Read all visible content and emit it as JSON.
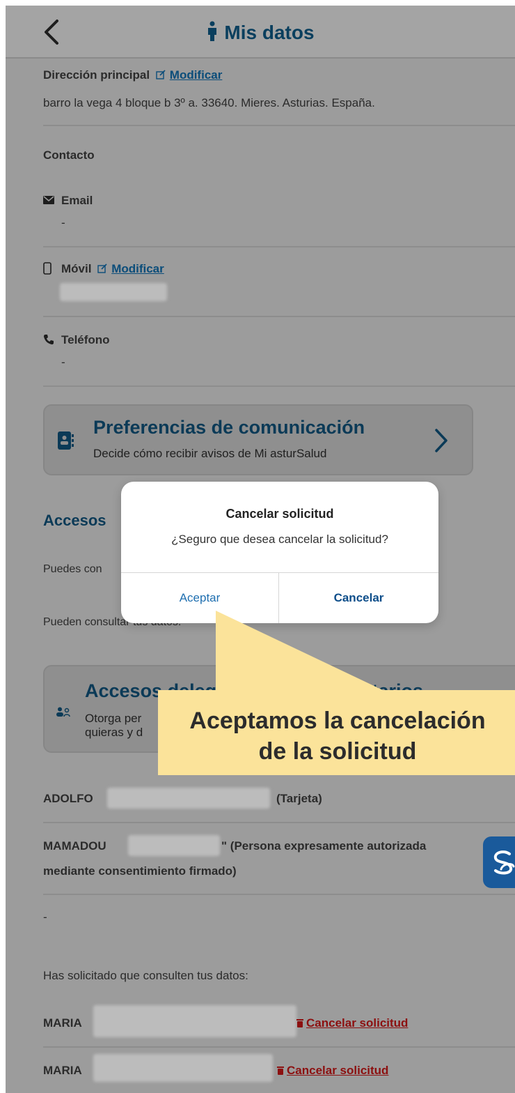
{
  "header": {
    "title": "Mis datos"
  },
  "address": {
    "label": "Dirección principal",
    "modify": "Modificar",
    "value": "barro la vega 4 bloque b 3º a. 33640. Mieres. Asturias. España."
  },
  "contact": {
    "heading": "Contacto",
    "email_label": "Email",
    "email_value": "-",
    "mobile_label": "Móvil",
    "mobile_modify": "Modificar",
    "phone_label": "Teléfono",
    "phone_value": "-"
  },
  "preferences_card": {
    "title": "Preferencias de comunicación",
    "subtitle": "Decide cómo recibir avisos de Mi asturSalud"
  },
  "accesses": {
    "title_partial": "Accesos",
    "line1_partial": "Puedes con",
    "line2_partial": "Pueden consultar tus datos:"
  },
  "voluntary_card": {
    "title_left": "Accesos deleg",
    "title_right": "luntarios",
    "sub_line1": "Otorga per",
    "sub_line2": "quieras y d"
  },
  "authorized": [
    {
      "name": "ADOLFO",
      "suffix": "(Tarjeta)"
    },
    {
      "name": "MAMADOU",
      "suffix": "\" (Persona expresamente autorizada",
      "suffix2": "mediante consentimiento firmado)"
    }
  ],
  "dash": "-",
  "requested_intro": "Has solicitado que consulten tus datos:",
  "requests": [
    {
      "name": "MARIA",
      "action": "Cancelar solicitud"
    },
    {
      "name": "MARIA",
      "action": "Cancelar solicitud"
    }
  ],
  "dialog": {
    "title": "Cancelar solicitud",
    "message": "¿Seguro que desea cancelar la solicitud?",
    "accept": "Aceptar",
    "cancel": "Cancelar"
  },
  "callout": {
    "line1": "Aceptamos la cancelación",
    "line2": "de la solicitud"
  },
  "colors": {
    "overlay": "#9c9c9c",
    "title_blue": "#0b3a57",
    "link_blue": "#0b4d7a",
    "danger": "#8c1010",
    "callout_fill": "#fbe39a",
    "fab_blue": "#1a5a9b"
  }
}
